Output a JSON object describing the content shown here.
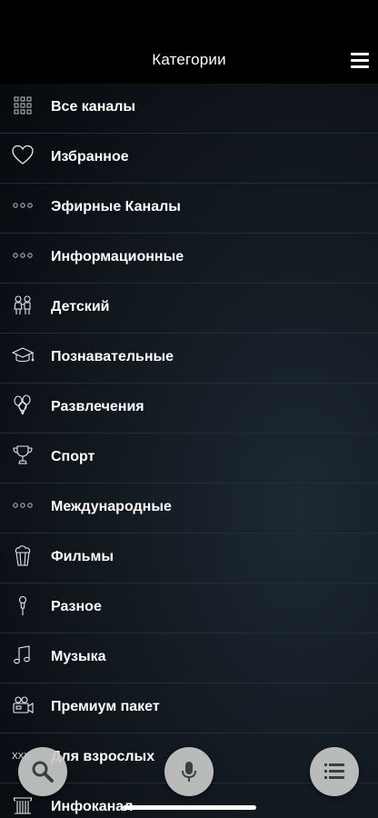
{
  "header": {
    "title": "Категории"
  },
  "categories": [
    {
      "label": "Все каналы",
      "icon": "grid-icon"
    },
    {
      "label": "Избранное",
      "icon": "heart-icon"
    },
    {
      "label": "Эфирные Каналы",
      "icon": "dots-icon"
    },
    {
      "label": "Информационные",
      "icon": "dots-icon"
    },
    {
      "label": "Детский",
      "icon": "kids-icon"
    },
    {
      "label": "Познавательные",
      "icon": "graduation-cap-icon"
    },
    {
      "label": "Развлечения",
      "icon": "balloons-icon"
    },
    {
      "label": "Спорт",
      "icon": "trophy-icon"
    },
    {
      "label": "Международные",
      "icon": "dots-icon"
    },
    {
      "label": "Фильмы",
      "icon": "popcorn-icon"
    },
    {
      "label": "Разное",
      "icon": "microphone-icon"
    },
    {
      "label": "Музыка",
      "icon": "music-note-icon"
    },
    {
      "label": "Премиум пакет",
      "icon": "camera-icon"
    },
    {
      "label": "Для взрослых",
      "icon": "xxx-icon"
    },
    {
      "label": "Инфоканал",
      "icon": "column-icon"
    }
  ],
  "adult_icon_text": "XXX",
  "colors": {
    "background": "#0a0f14",
    "divider": "#232d36",
    "fab": "#c8c8c8",
    "text": "#ffffff"
  }
}
